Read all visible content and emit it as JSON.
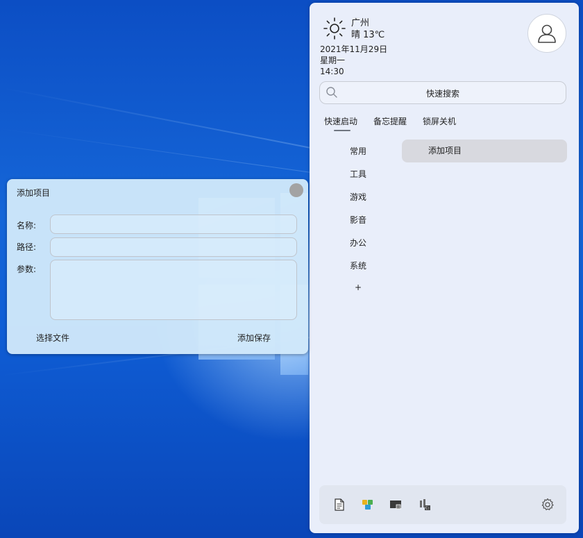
{
  "launcher": {
    "city": "广州",
    "weather": "晴  13℃",
    "date": "2021年11月29日",
    "weekday": "星期一",
    "time": "14:30",
    "search_label": "快速搜索",
    "tabs": [
      "快速启动",
      "备忘提醒",
      "锁屏关机"
    ],
    "categories": [
      "常用",
      "工具",
      "游戏",
      "影音",
      "办公",
      "系统",
      "+"
    ],
    "add_item_label": "添加项目",
    "toolbar_icons": [
      "file-icon",
      "puzzle-icon",
      "screen-icon",
      "terminal-icon",
      "gear-icon"
    ]
  },
  "dialog": {
    "title": "添加项目",
    "name_label": "名称:",
    "path_label": "路径:",
    "params_label": "参数:",
    "name_value": "",
    "path_value": "",
    "params_value": "",
    "choose_file_label": "选择文件",
    "save_label": "添加保存"
  },
  "colors": {
    "panel_bg": "#e9eefa",
    "dialog_bg": "#d0e8fa",
    "selected_item_bg": "#d8d9df",
    "desktop_blue": "#1459c9"
  }
}
